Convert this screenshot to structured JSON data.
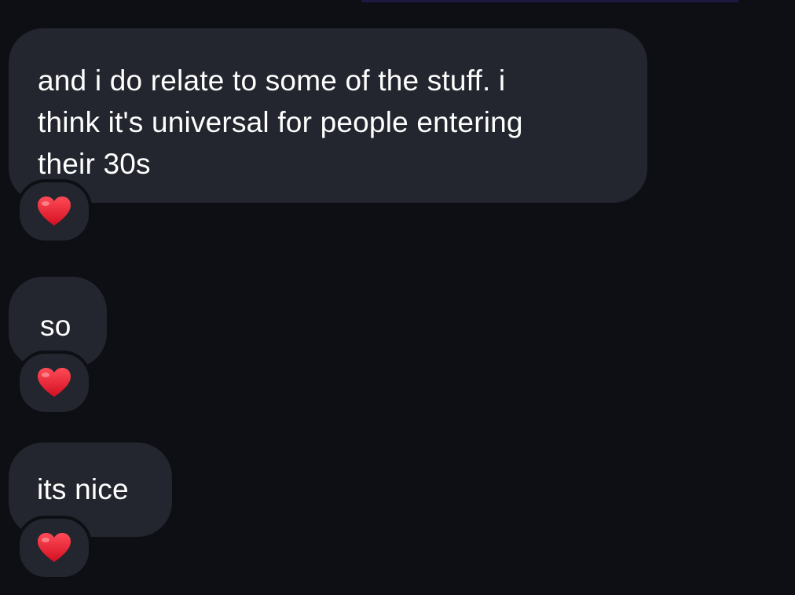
{
  "messages": [
    {
      "text": "and i do relate to some of the stuff. i\nthink it's universal for people entering\ntheir 30s",
      "reaction": "red-heart-icon"
    },
    {
      "text": "so",
      "reaction": "red-heart-icon"
    },
    {
      "text": "its nice",
      "reaction": "red-heart-icon"
    }
  ],
  "colors": {
    "background": "#0d0f14",
    "bubble": "#23262e",
    "text": "#ffffff",
    "heart": "#e0142a"
  }
}
